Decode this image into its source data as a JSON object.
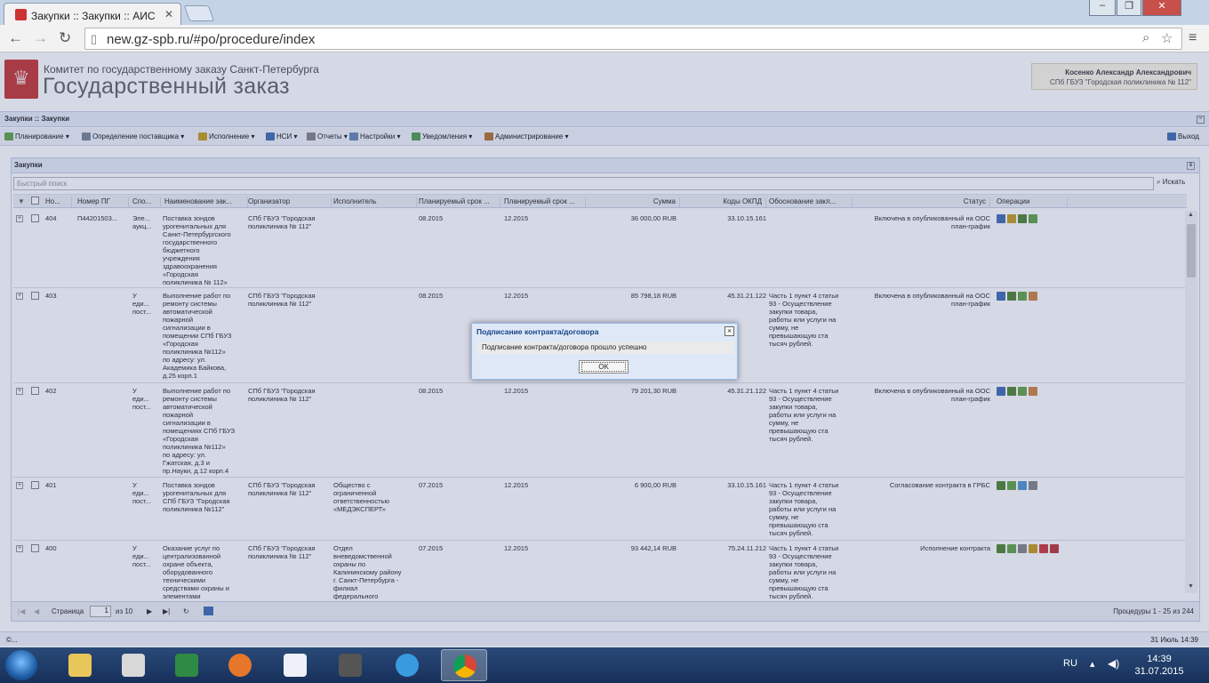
{
  "browser": {
    "tab_title": "Закупки :: Закупки :: АИС",
    "url": "new.gz-spb.ru/#po/procedure/index",
    "window_buttons": [
      "‒",
      "❐",
      "✕"
    ]
  },
  "header": {
    "org_name": "Комитет по государственному заказу Санкт-Петербурга",
    "system_name": "Государственный заказ",
    "user_name": "Косенко Александр Александрович",
    "user_org": "СПб ГБУЗ \"Городская поликлиника № 112\""
  },
  "panel": {
    "breadcrumb": "Закупки :: Закупки",
    "menu": [
      {
        "label": "Планирование",
        "color": "#6aa84f"
      },
      {
        "label": "Определение поставщика",
        "color": "#7f8c9a"
      },
      {
        "label": "Исполнение",
        "color": "#c9a227"
      },
      {
        "label": "НСИ",
        "color": "#4a74b8"
      },
      {
        "label": "Отчеты",
        "color": "#8a8a8a"
      },
      {
        "label": "Настройки",
        "color": "#6d8cb5"
      },
      {
        "label": "Уведомления",
        "color": "#5aa05a"
      },
      {
        "label": "Администрирование",
        "color": "#b87b3a"
      }
    ],
    "logout": "Выход"
  },
  "grid": {
    "title": "Закупки",
    "search_placeholder": "Быстрый поиск",
    "search_button": "Искать",
    "columns": [
      "Но...",
      "Номер ПГ",
      "Спо...",
      "Наименование зак...",
      "Организатор",
      "Исполнитель",
      "Планируемый срок ...",
      "Планируемый срок ...",
      "Сумма",
      "Коды ОКПД",
      "Обоснование закл...",
      "Статус",
      "Операции"
    ],
    "rows": [
      {
        "no": "404",
        "pg": "П44201503...",
        "method": "Эле...\nаукц...",
        "name": "Поставка зондов\nурогенитальных для\nСанкт-Петербургского\nгосударственного\nбюджетного\nучреждения\nздравоохранения\n«Городская\nполиклиника № 112»",
        "org": "СПб ГБУЗ \"Городская\nполиклиника № 112\"",
        "executor": "",
        "start": "08.2015",
        "end": "12.2015",
        "sum": "36 000,00 RUB",
        "okpd": "33.10.15.161",
        "reason": "",
        "status": "Включена в опубликованный на ООС\nплан-график",
        "ops": [
          "#4a74b8",
          "#c9a227",
          "#5a8a3a",
          "#6aa84f"
        ]
      },
      {
        "no": "403",
        "pg": "",
        "method": "У\nеди...\nпост...",
        "name": "Выполнение работ по\nремонту системы\nавтоматической\nпожарной\nсигнализации в\nпомещении СПб ГБУЗ\n«Городская\nполиклиника №112»\nпо адресу: ул.\nАкадемика Байкова,\nд.25 корп.1",
        "org": "СПб ГБУЗ \"Городская\nполиклиника № 112\"",
        "executor": "",
        "start": "08.2015",
        "end": "12.2015",
        "sum": "85 798,18 RUB",
        "okpd": "45.31.21.122",
        "reason": "Часть 1 пункт 4 статьи\n93 - Осуществление\nзакупки товара,\nработы или услуги на\nсумму, не\nпревышающую ста\nтысяч рублей.",
        "status": "Включена в опубликованный на ООС\nплан-график",
        "ops": [
          "#4a74b8",
          "#5a8a3a",
          "#6aa84f",
          "#d08a4a"
        ]
      },
      {
        "no": "402",
        "pg": "",
        "method": "У\nеди...\nпост...",
        "name": "Выполнение работ по\nремонту системы\nавтоматической\nпожарной\nсигнализации в\nпомещениях СПб ГБУЗ\n«Городская\nполиклиника №112»\nпо адресу: ул.\nГжатская, д.3 и\nпр.Науки, д.12 корп.4",
        "org": "СПб ГБУЗ \"Городская\nполиклиника № 112\"",
        "executor": "",
        "start": "08.2015",
        "end": "12.2015",
        "sum": "79 201,30 RUB",
        "okpd": "45.31.21.122",
        "reason": "Часть 1 пункт 4 статьи\n93 - Осуществление\nзакупки товара,\nработы или услуги на\nсумму, не\nпревышающую ста\nтысяч рублей.",
        "status": "Включена в опубликованный на ООС\nплан-график",
        "ops": [
          "#4a74b8",
          "#5a8a3a",
          "#6aa84f",
          "#d08a4a"
        ]
      },
      {
        "no": "401",
        "pg": "",
        "method": "У\nеди...\nпост...",
        "name": "Поставка зондов\nурогенитальных для\nСПб ГБУЗ \"Городская\nполиклиника №112\"",
        "org": "СПб ГБУЗ \"Городская\nполиклиника № 112\"",
        "executor": "Общество с\nограниченной\nответственностью\n«МЕДЭКСПЕРТ»",
        "start": "07.2015",
        "end": "12.2015",
        "sum": "6 900,00 RUB",
        "okpd": "33.10.15.161",
        "reason": "Часть 1 пункт 4 статьи\n93 - Осуществление\nзакупки товара,\nработы или услуги на\nсумму, не\nпревышающую ста\nтысяч рублей.",
        "status": "Согласование контракта в ГРБС",
        "ops": [
          "#5a8a3a",
          "#6aa84f",
          "#5a9ad0",
          "#8a8a8a"
        ]
      },
      {
        "no": "400",
        "pg": "",
        "method": "У\nеди...\nпост...",
        "name": "Оказание услуг по\nцентрализованной\nохране объекта,\nоборудованного\nтехническими\nсредствами охраны и\nэлементами\nтехнической",
        "org": "СПб ГБУЗ \"Городская\nполиклиника № 112\"",
        "executor": "Отдел\nвневедомственной\nохраны по\nКалининскому району\nг. Санкт-Петербурга -\nфилиал\nфедерального\nгосударственного",
        "start": "07.2015",
        "end": "12.2015",
        "sum": "93 442,14 RUB",
        "okpd": "75.24.11.212",
        "reason": "Часть 1 пункт 4 статьи\n93 - Осуществление\nзакупки товара,\nработы или услуги на\nсумму, не\nпревышающую ста\nтысяч рублей.",
        "status": "Исполнение контракта",
        "ops": [
          "#5a8a3a",
          "#6aa84f",
          "#8a8a8a",
          "#c9a227",
          "#d04040",
          "#c04040"
        ]
      }
    ],
    "pager": {
      "page_label": "Страница",
      "page": "1",
      "of": "из 10",
      "summary": "Процедуры 1 - 25 из 244"
    }
  },
  "footer": {
    "left": "©...",
    "right": "31 Июль 14:39"
  },
  "dialog": {
    "title": "Подписание контракта/договора",
    "message": "Подписание контракта/договора прошло успешно",
    "ok": "OK",
    "close": "×"
  },
  "taskbar": {
    "lang": "RU",
    "time": "14:39",
    "date": "31.07.2015"
  }
}
